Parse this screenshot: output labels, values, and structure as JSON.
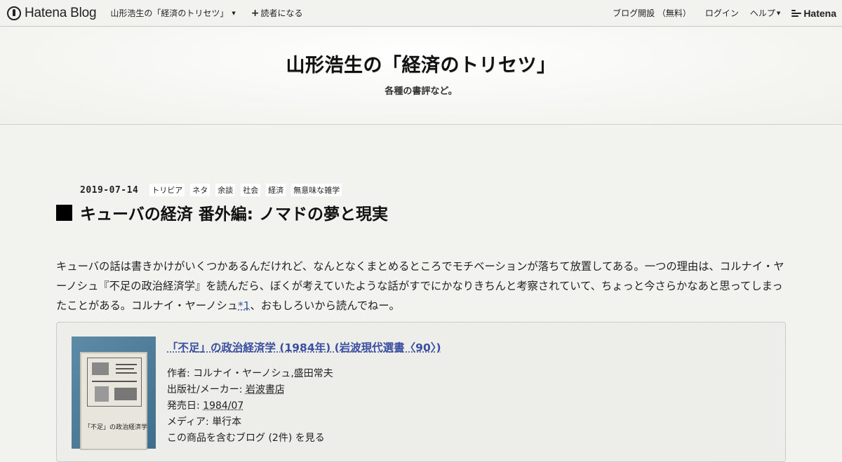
{
  "navbar": {
    "brand": "Hatena Blog",
    "blog_name": "山形浩生の「経済のトリセツ」",
    "subscribe": "読者になる",
    "open_blog": "ブログ開設 （無料）",
    "login": "ログイン",
    "help": "ヘルプ",
    "hatena": "Hatena"
  },
  "header": {
    "title": "山形浩生の「経済のトリセツ」",
    "description": "各種の書評など。"
  },
  "entry": {
    "date": "2019-07-14",
    "categories": [
      "トリビア",
      "ネタ",
      "余談",
      "社会",
      "経済",
      "無意味な雑学"
    ],
    "title": "キューバの経済 番外編: ノマドの夢と現実",
    "body_part1": "キューバの話は書きかけがいくつかあるんだけれど、なんとなくまとめるところでモチベーションが落ちて放置してある。一つの理由は、コルナイ・ヤーノシュ『不足の政治経済学』を読んだら、ぼくが考えていたような話がすでにかなりきちんと考察されていて、ちょっと今さらかなあと思ってしまったことがある。コルナイ・ヤーノシュ",
    "footnote": "*1",
    "body_part2": "、おもしろいから読んでねー。"
  },
  "product": {
    "title": "「不足」の政治経済学 (1984年) (岩波現代選書〈90〉)",
    "author_label": "作者: ",
    "author": "コルナイ・ヤーノシュ,盛田常夫",
    "publisher_label": "出版社/メーカー: ",
    "publisher": "岩波書店",
    "release_label": "発売日: ",
    "release": "1984/07",
    "media_label": "メディア: ",
    "media": "単行本",
    "blogs_link": "この商品を含むブログ (2件) を見る",
    "cover_text": "「不足」の政治経済学"
  }
}
